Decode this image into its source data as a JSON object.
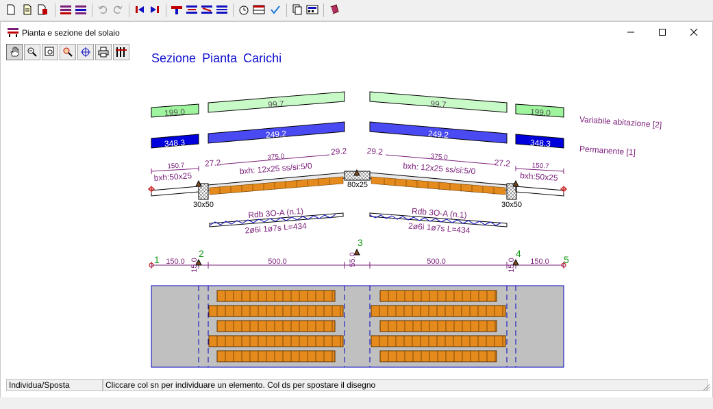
{
  "window": {
    "title": "Pianta e sezione del solaio"
  },
  "view_tabs": [
    "Sezione",
    "Pianta",
    "Carichi"
  ],
  "status": {
    "mode": "Individua/Sposta",
    "hint": "Cliccare col sn per individuare un elemento. Col ds per spostare il disegno"
  },
  "loads": {
    "variable_label": "Variabile abitazione [2]",
    "permanent_label": "Permanente [1]",
    "variable_values": [
      "199.0",
      "99.7",
      "99.7",
      "199.0"
    ],
    "permanent_values": [
      "348.3",
      "249.2",
      "249.2",
      "348.3"
    ]
  },
  "section": {
    "left_overhang_len": "150.7",
    "right_overhang_len": "150.7",
    "left_overhang_label": "bxh:50x25",
    "right_overhang_label": "bxh:50x25",
    "span_len_left": "375.0",
    "span_len_right": "375.0",
    "edge_left_1": "27.2",
    "edge_left_2": "29.2",
    "edge_right_1": "29.2",
    "edge_right_2": "27.2",
    "span_label_left": "bxh: 12x25  ss/si:5/0",
    "span_label_right": "bxh: 12x25  ss/si:5/0",
    "beam_left": "30x50",
    "beam_center": "80x25",
    "beam_right": "30x50"
  },
  "reinforcement": {
    "left_title": "Rdb 3O-A (n.1)",
    "left_bars": "2ø6i 1ø7s L=434",
    "right_title": "Rdb 3O-A (n.1)",
    "right_bars": "2ø6i 1ø7s L=434"
  },
  "axis": {
    "nodes": [
      "1",
      "2",
      "3",
      "4",
      "5"
    ],
    "dims": [
      "150.0",
      "15.0",
      "500.0",
      "55.0",
      "500.0",
      "15.0",
      "150.0"
    ]
  },
  "colors": {
    "variable_fill": "#9ef59e",
    "permanent_fill": "#0000dd",
    "permanent_center_fill": "#4a4af2",
    "label_purple": "#7a1e7a",
    "node_green": "#119911",
    "brick_orange": "#e58a1c",
    "plan_gray": "#c0c0c0"
  },
  "toolbar_icons": [
    "new-file-icon",
    "open-file-icon",
    "save-file-icon",
    "grid-icon",
    "grid-edit-icon",
    "undo-icon",
    "redo-icon",
    "first-icon",
    "last-icon",
    "beam-t-icon",
    "beam-i-icon",
    "beam-z-icon",
    "beam-c-icon",
    "clock-icon",
    "table-icon",
    "check-icon",
    "copy-icon",
    "calc-icon",
    "book-icon"
  ],
  "inner_tool_icons": [
    "hand-icon",
    "zoom-icon",
    "zoom-window-icon",
    "zoom-extents-icon",
    "crosshair-icon",
    "print-icon",
    "columns-icon"
  ]
}
